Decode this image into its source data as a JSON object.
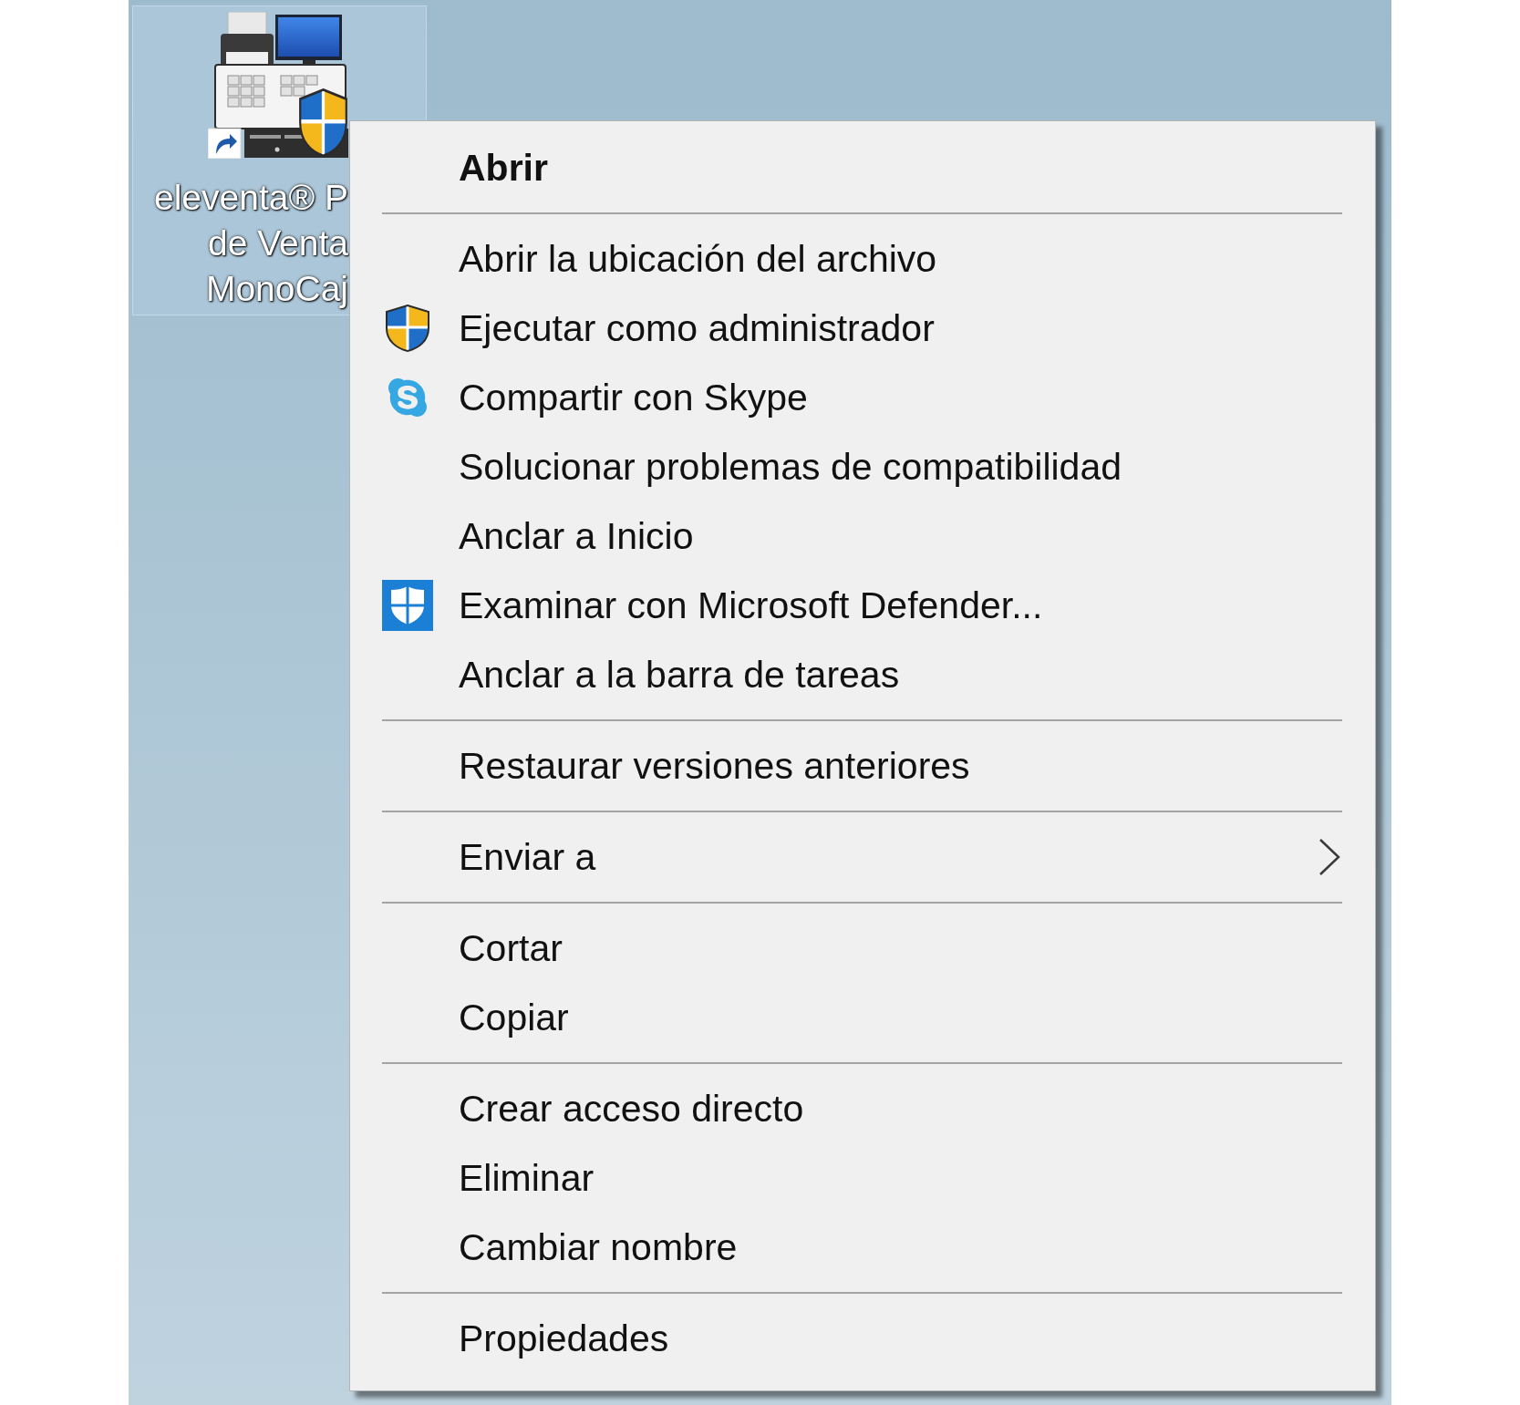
{
  "desktop": {
    "shortcut": {
      "label_lines": [
        "eleventa® P",
        "de Venta",
        "MonoCaj"
      ],
      "selected": true
    }
  },
  "context_menu": {
    "items": [
      {
        "kind": "default",
        "label": "Abrir"
      },
      {
        "kind": "separator"
      },
      {
        "kind": "plain",
        "label": "Abrir la ubicación del archivo"
      },
      {
        "kind": "elevated",
        "label": "Ejecutar como administrador"
      },
      {
        "kind": "share",
        "label": "Compartir con Skype"
      },
      {
        "kind": "plain",
        "label": "Solucionar problemas de compatibilidad"
      },
      {
        "kind": "plain",
        "label": "Anclar a Inicio"
      },
      {
        "kind": "scan",
        "label": "Examinar con Microsoft Defender..."
      },
      {
        "kind": "plain",
        "label": "Anclar a la barra de tareas"
      },
      {
        "kind": "separator"
      },
      {
        "kind": "plain",
        "label": "Restaurar versiones anteriores"
      },
      {
        "kind": "separator"
      },
      {
        "kind": "submenu",
        "label": "Enviar a"
      },
      {
        "kind": "separator"
      },
      {
        "kind": "plain",
        "label": "Cortar"
      },
      {
        "kind": "plain",
        "label": "Copiar"
      },
      {
        "kind": "separator"
      },
      {
        "kind": "plain",
        "label": "Crear acceso directo"
      },
      {
        "kind": "plain",
        "label": "Eliminar"
      },
      {
        "kind": "plain",
        "label": "Cambiar nombre"
      },
      {
        "kind": "separator"
      },
      {
        "kind": "plain",
        "label": "Propiedades"
      }
    ]
  }
}
